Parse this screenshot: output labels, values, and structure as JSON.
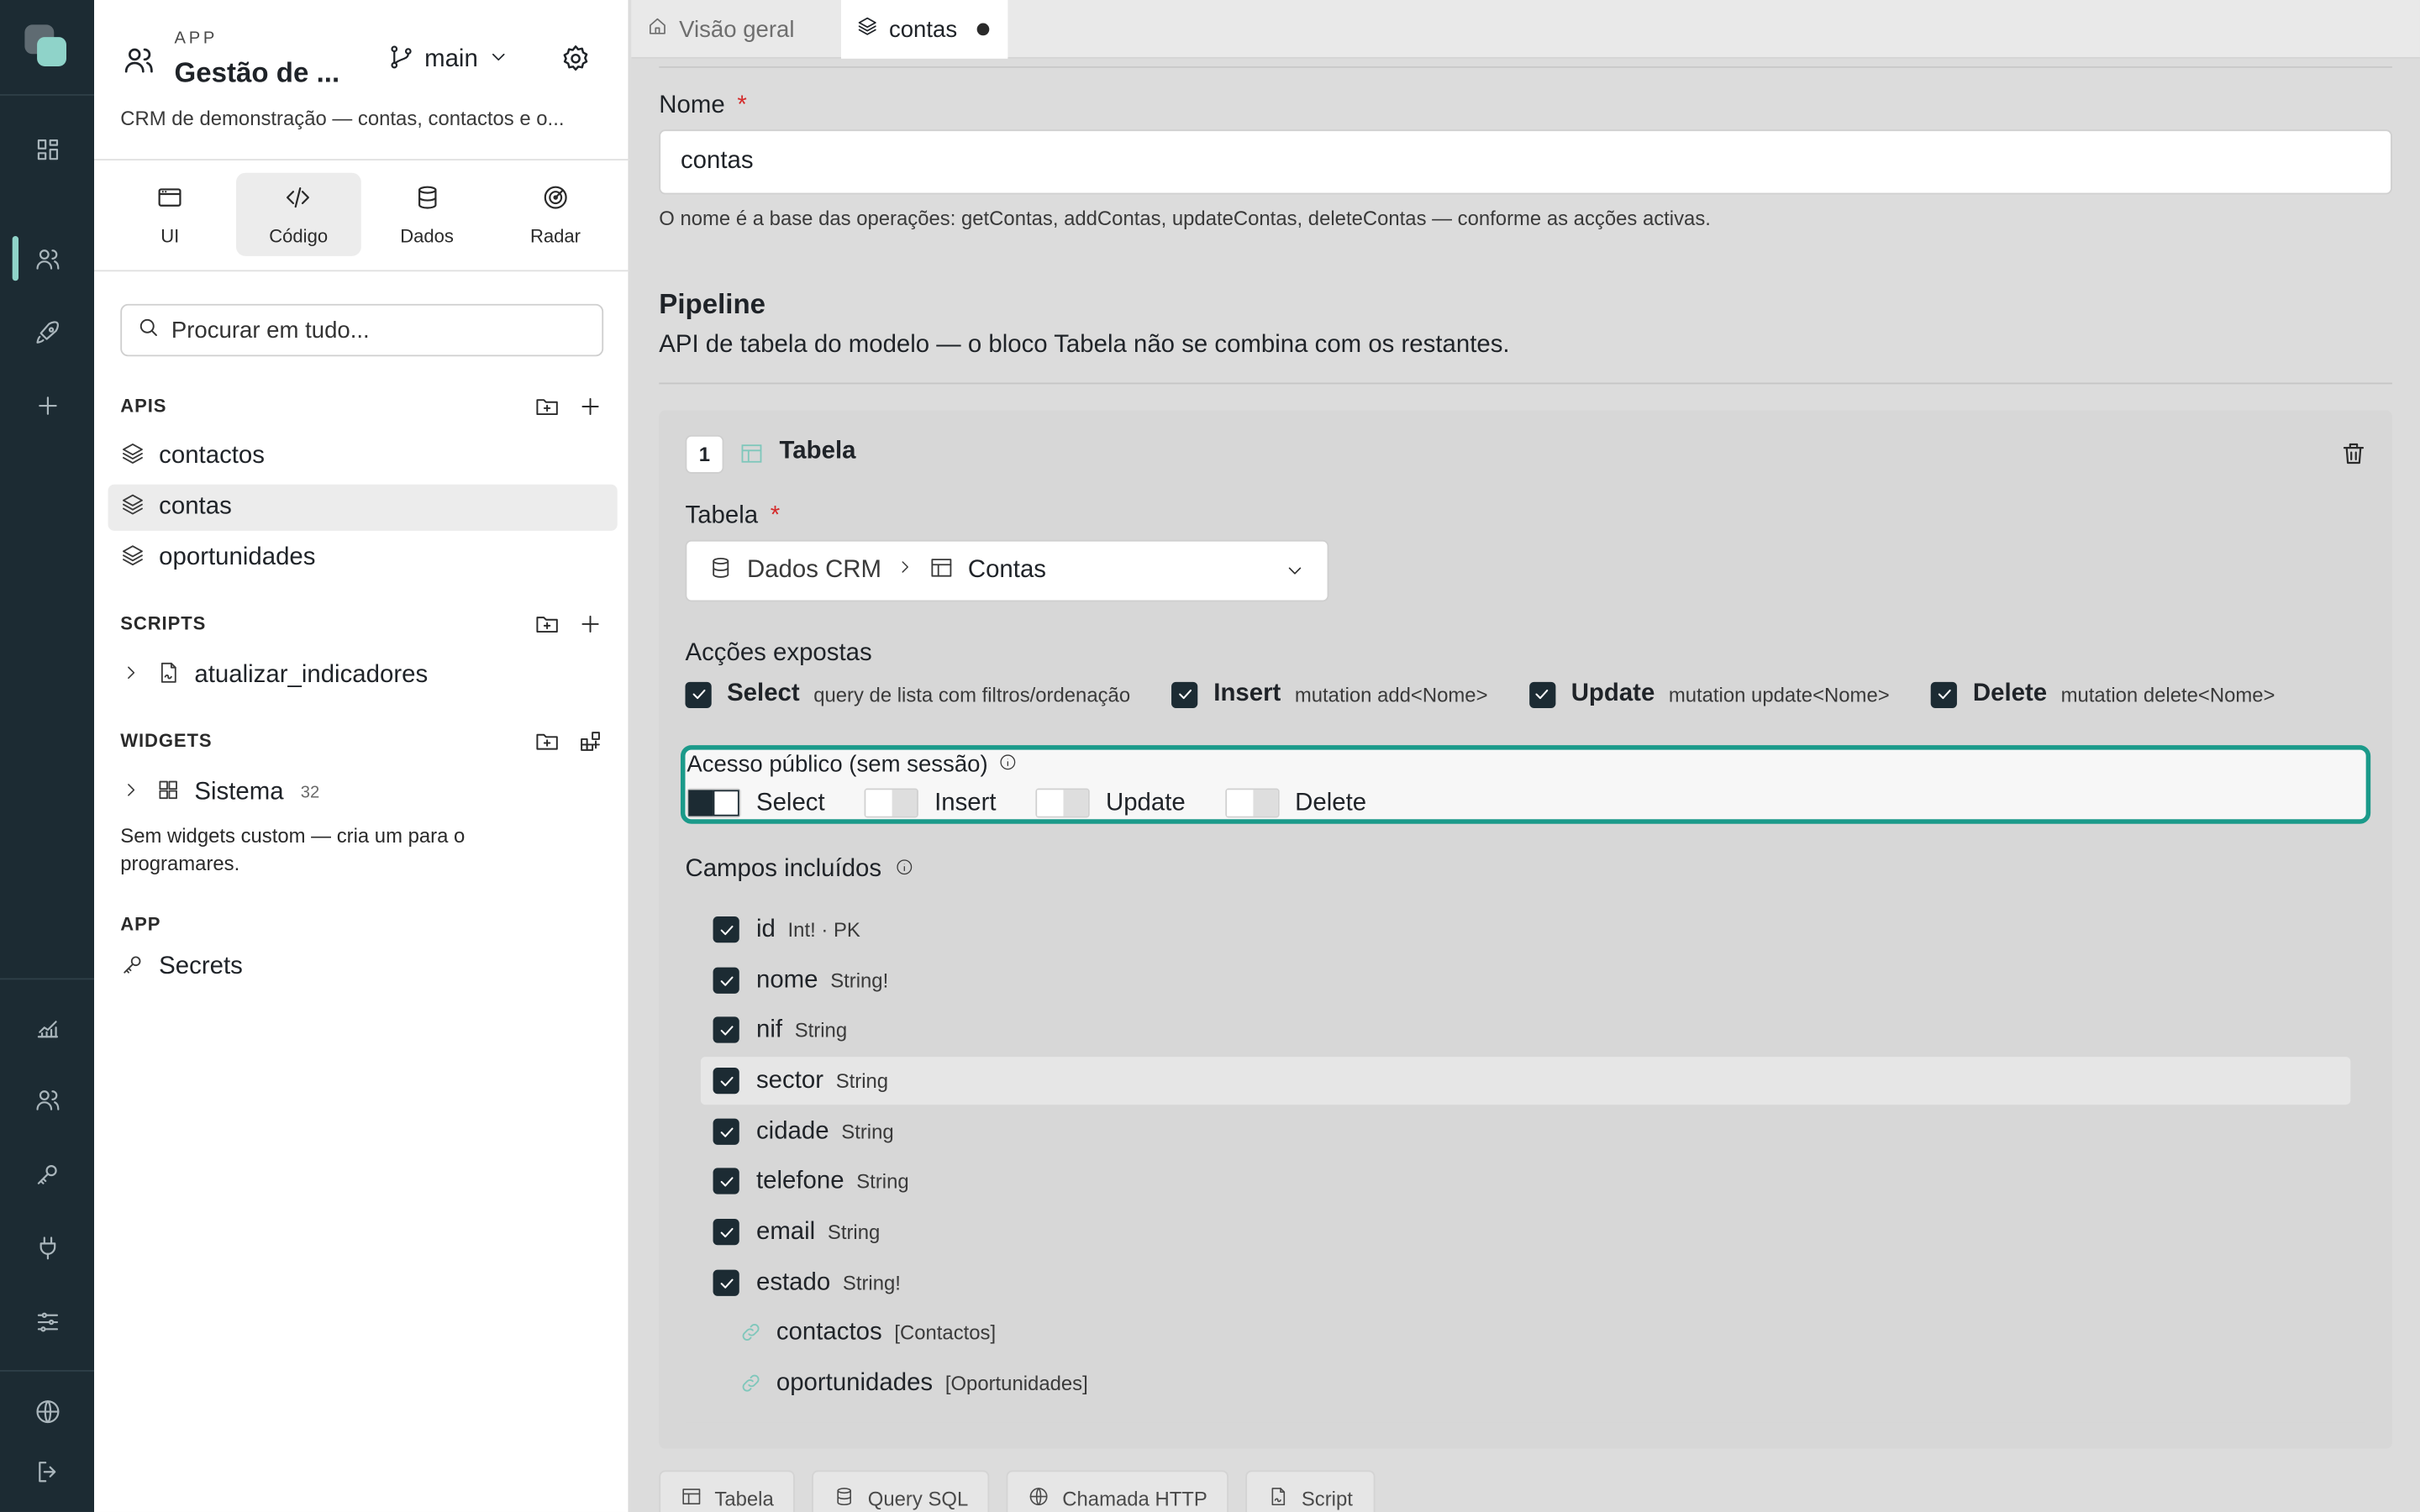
{
  "app": {
    "kicker": "APP",
    "title": "Gestão de ...",
    "branch": "main",
    "description": "CRM de demonstração — contas, contactos e o..."
  },
  "modes": [
    {
      "label": "UI",
      "icon": "window-icon"
    },
    {
      "label": "Código",
      "icon": "code-icon"
    },
    {
      "label": "Dados",
      "icon": "database-icon"
    },
    {
      "label": "Radar",
      "icon": "radar-icon"
    }
  ],
  "search": {
    "placeholder": "Procurar em tudo..."
  },
  "sections": {
    "apis": {
      "label": "APIS",
      "items": [
        "contactos",
        "contas",
        "oportunidades"
      ],
      "active": "contas"
    },
    "scripts": {
      "label": "SCRIPTS",
      "items": [
        "atualizar_indicadores"
      ]
    },
    "widgets": {
      "label": "WIDGETS",
      "group": "Sistema",
      "count": "32",
      "empty": "Sem widgets custom — cria um para o programares."
    },
    "app": {
      "label": "APP",
      "items": [
        "Secrets"
      ]
    }
  },
  "tabs": [
    {
      "label": "Visão geral",
      "icon": "home-icon"
    },
    {
      "label": "contas",
      "icon": "layers-icon",
      "dirty": true
    }
  ],
  "form": {
    "name_label": "Nome",
    "required_mark": "*",
    "name_value": "contas",
    "name_hint": "O nome é a base das operações: getContas, addContas, updateContas, deleteContas — conforme as acções activas.",
    "pipeline_title": "Pipeline",
    "pipeline_desc": "API de tabela do modelo — o bloco Tabela não se combina com os restantes."
  },
  "block": {
    "step": "1",
    "title": "Tabela",
    "table_label": "Tabela",
    "source": "Dados CRM",
    "table": "Contas",
    "actions_label": "Acções expostas",
    "actions": [
      {
        "name": "Select",
        "desc": "query de lista com filtros/ordenação",
        "checked": true
      },
      {
        "name": "Insert",
        "desc": "mutation add<Nome>",
        "checked": true
      },
      {
        "name": "Update",
        "desc": "mutation update<Nome>",
        "checked": true
      },
      {
        "name": "Delete",
        "desc": "mutation delete<Nome>",
        "checked": true
      }
    ],
    "public_label": "Acesso público (sem sessão)",
    "public": [
      {
        "name": "Select",
        "on": true
      },
      {
        "name": "Insert",
        "on": false
      },
      {
        "name": "Update",
        "on": false
      },
      {
        "name": "Delete",
        "on": false
      }
    ],
    "fields_label": "Campos incluídos",
    "fields": [
      {
        "name": "id",
        "type": "Int! · PK",
        "checked": true
      },
      {
        "name": "nome",
        "type": "String!",
        "checked": true
      },
      {
        "name": "nif",
        "type": "String",
        "checked": true
      },
      {
        "name": "sector",
        "type": "String",
        "checked": true
      },
      {
        "name": "cidade",
        "type": "String",
        "checked": true
      },
      {
        "name": "telefone",
        "type": "String",
        "checked": true
      },
      {
        "name": "email",
        "type": "String",
        "checked": true
      },
      {
        "name": "estado",
        "type": "String!",
        "checked": true
      },
      {
        "name": "contactos",
        "type": "[Contactos]",
        "relation": true
      },
      {
        "name": "oportunidades",
        "type": "[Oportunidades]",
        "relation": true
      }
    ]
  },
  "add_blocks": [
    {
      "label": "Tabela",
      "icon": "table-icon"
    },
    {
      "label": "Query SQL",
      "icon": "database-icon"
    },
    {
      "label": "Chamada HTTP",
      "icon": "globe-icon"
    },
    {
      "label": "Script",
      "icon": "script-icon"
    }
  ],
  "colors": {
    "rail": "#1c2b33",
    "accent": "#8fd3c9",
    "focus": "#1b9a8a",
    "required": "#d42b2b"
  }
}
